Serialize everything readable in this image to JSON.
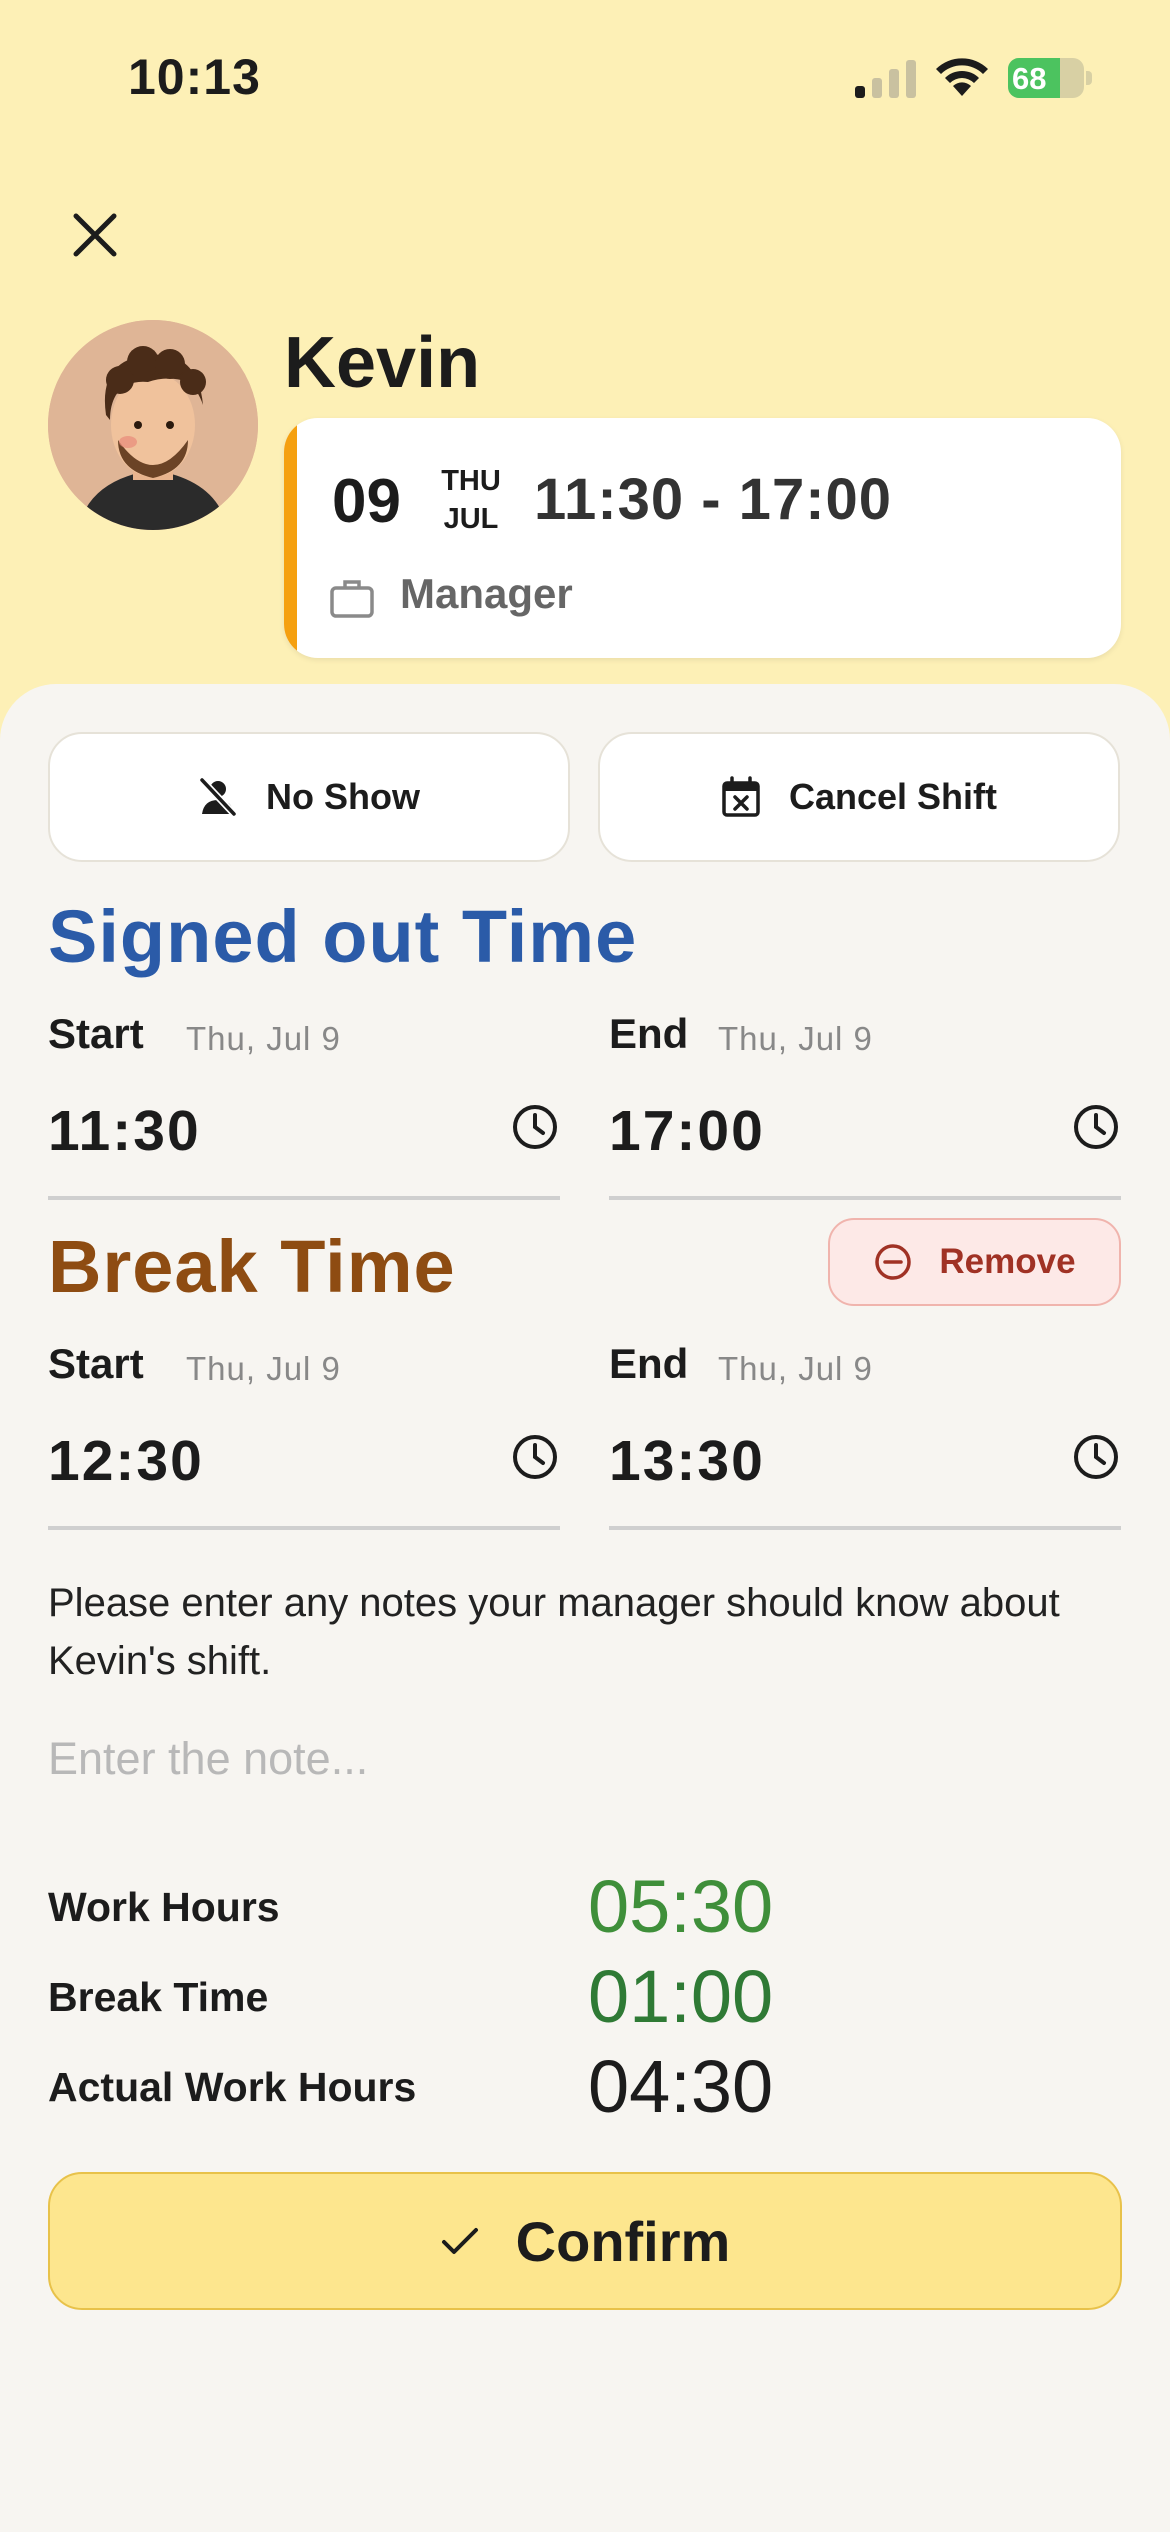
{
  "status_bar": {
    "time": "10:13",
    "battery": "68",
    "battery_level_percent": 68,
    "battery_color": "#4cc35f"
  },
  "header": {
    "close_icon": "close-icon",
    "employee_name": "Kevin",
    "avatar": "avatar-illustration"
  },
  "shift": {
    "day": "09",
    "weekday": "THU",
    "month": "JUL",
    "time_range": "11:30 - 17:00",
    "role": "Manager",
    "role_icon": "briefcase-icon",
    "accent_color": "#f5a010"
  },
  "actions": {
    "no_show_label": "No Show",
    "no_show_icon": "person-off-icon",
    "cancel_label": "Cancel Shift",
    "cancel_icon": "calendar-cancel-icon"
  },
  "signed_out": {
    "title": "Signed out Time",
    "title_color": "#2b5ba8",
    "start": {
      "label": "Start",
      "date": "Thu, Jul 9",
      "value": "11:30"
    },
    "end": {
      "label": "End",
      "date": "Thu, Jul 9",
      "value": "17:00"
    }
  },
  "break": {
    "title": "Break Time",
    "title_color": "#8e4c12",
    "remove_label": "Remove",
    "remove_icon": "minus-circle-icon",
    "start": {
      "label": "Start",
      "date": "Thu, Jul 9",
      "value": "12:30"
    },
    "end": {
      "label": "End",
      "date": "Thu, Jul 9",
      "value": "13:30"
    }
  },
  "notes": {
    "prompt": "Please enter any notes your manager should know about Kevin's shift.",
    "placeholder": "Enter the note...",
    "value": ""
  },
  "summary": {
    "work_hours_label": "Work Hours",
    "work_hours_value": "05:30",
    "break_time_label": "Break Time",
    "break_time_value": "01:00",
    "actual_label": "Actual Work Hours",
    "actual_value": "04:30",
    "green_color": "#3f8f3a"
  },
  "confirm": {
    "label": "Confirm",
    "icon": "check-icon"
  }
}
